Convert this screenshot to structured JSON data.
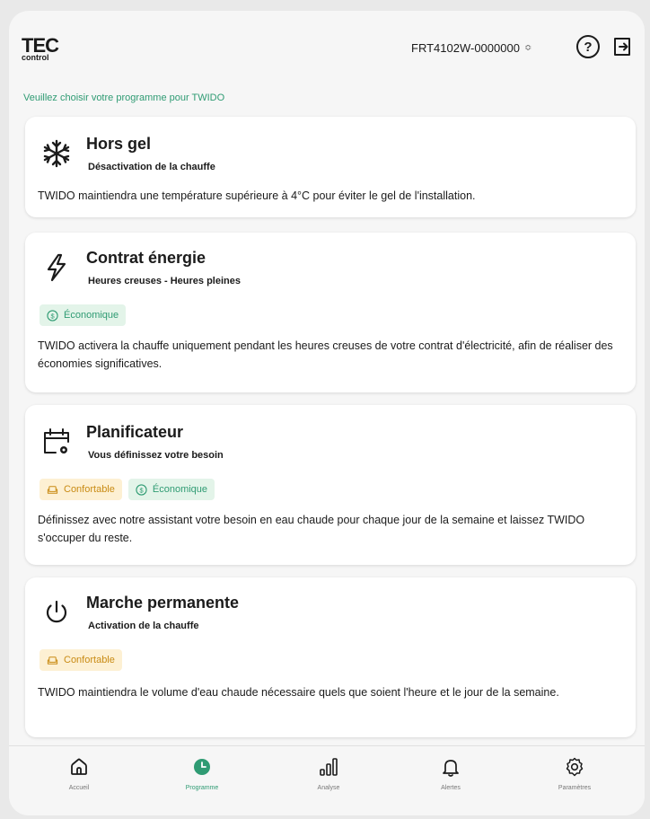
{
  "header": {
    "logo_main": "TEC",
    "logo_sub": "control",
    "device_id": "FRT4102W-0000000",
    "device_sort_glyph": "≎",
    "help_glyph": "?"
  },
  "subtitle": "Veuillez choisir votre programme pour TWIDO",
  "programs": [
    {
      "icon": "snowflake-icon",
      "title": "Hors gel",
      "subtitle": "Désactivation de la chauffe",
      "tags": [],
      "description": "TWIDO maintiendra une température supérieure à 4°C pour éviter le gel de l'installation."
    },
    {
      "icon": "lightning-icon",
      "title": "Contrat énergie",
      "subtitle": "Heures creuses - Heures pleines",
      "tags": [
        "Économique"
      ],
      "description": "TWIDO activera la chauffe uniquement pendant les heures creuses de votre contrat d'électricité, afin de réaliser des économies significatives."
    },
    {
      "icon": "calendar-gear-icon",
      "title": "Planificateur",
      "subtitle": "Vous définissez votre besoin",
      "tags": [
        "Confortable",
        "Économique"
      ],
      "description": "Définissez avec notre assistant votre besoin en eau chaude pour chaque jour de la semaine et laissez TWIDO s'occuper du reste."
    },
    {
      "icon": "power-icon",
      "title": "Marche permanente",
      "subtitle": "Activation de la chauffe",
      "tags": [
        "Confortable"
      ],
      "description": "TWIDO maintiendra le volume d'eau chaude nécessaire quels que soient l'heure et le jour de la semaine."
    }
  ],
  "nav": [
    {
      "label": "Accueil",
      "icon": "home-icon",
      "active": false
    },
    {
      "label": "Programme",
      "icon": "clock-icon",
      "active": true
    },
    {
      "label": "Analyse",
      "icon": "bar-chart-icon",
      "active": false
    },
    {
      "label": "Alertes",
      "icon": "bell-icon",
      "active": false
    },
    {
      "label": "Paramètres",
      "icon": "gear-icon",
      "active": false
    }
  ],
  "colors": {
    "accent_green": "#2f9b73",
    "eco_bg": "#e3f4e9",
    "comfort_bg": "#fdf0d3",
    "comfort_fg": "#c98b14"
  }
}
